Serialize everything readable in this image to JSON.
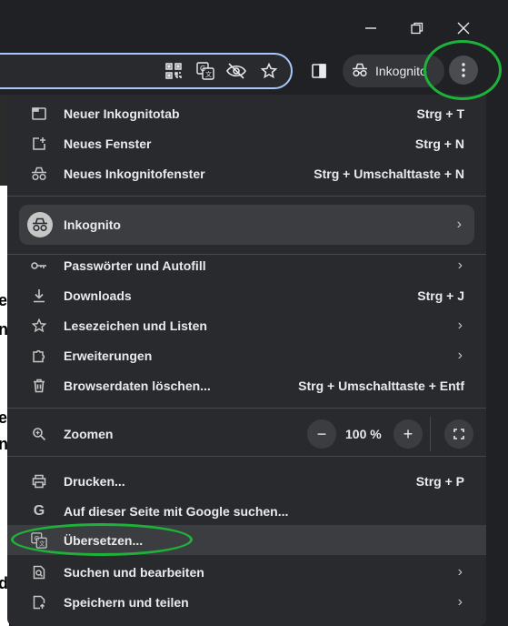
{
  "window": {
    "minimize_icon": "minimize-icon",
    "maximize_icon": "restore-icon",
    "close_icon": "close-icon"
  },
  "toolbar": {
    "incognito_label": "Inkognito",
    "icons": [
      "qr-code-icon",
      "translate-icon",
      "eye-off-icon",
      "star-icon",
      "side-panel-icon"
    ]
  },
  "menu": {
    "new_incognito_tab": {
      "label": "Neuer Inkognitotab",
      "shortcut": "Strg + T"
    },
    "new_window": {
      "label": "Neues Fenster",
      "shortcut": "Strg + N"
    },
    "new_incognito_window": {
      "label": "Neues Inkognitofenster",
      "shortcut": "Strg + Umschalttaste + N"
    },
    "profile": {
      "label": "Inkognito"
    },
    "passwords": {
      "label": "Passwörter und Autofill"
    },
    "downloads": {
      "label": "Downloads",
      "shortcut": "Strg + J"
    },
    "bookmarks": {
      "label": "Lesezeichen und Listen"
    },
    "extensions": {
      "label": "Erweiterungen"
    },
    "clear_data": {
      "label": "Browserdaten löschen...",
      "shortcut": "Strg + Umschalttaste + Entf"
    },
    "zoom": {
      "label": "Zoomen",
      "value": "100 %",
      "minus": "−",
      "plus": "+"
    },
    "print": {
      "label": "Drucken...",
      "shortcut": "Strg + P"
    },
    "google_search": {
      "label": "Auf dieser Seite mit Google suchen..."
    },
    "translate": {
      "label": "Übersetzen..."
    },
    "find_edit": {
      "label": "Suchen und bearbeiten"
    },
    "save_share": {
      "label": "Speichern und teilen"
    }
  },
  "colors": {
    "background": "#202124",
    "menu": "#282a2d",
    "highlight": "#3c3d40",
    "annotation": "#1db33a"
  }
}
